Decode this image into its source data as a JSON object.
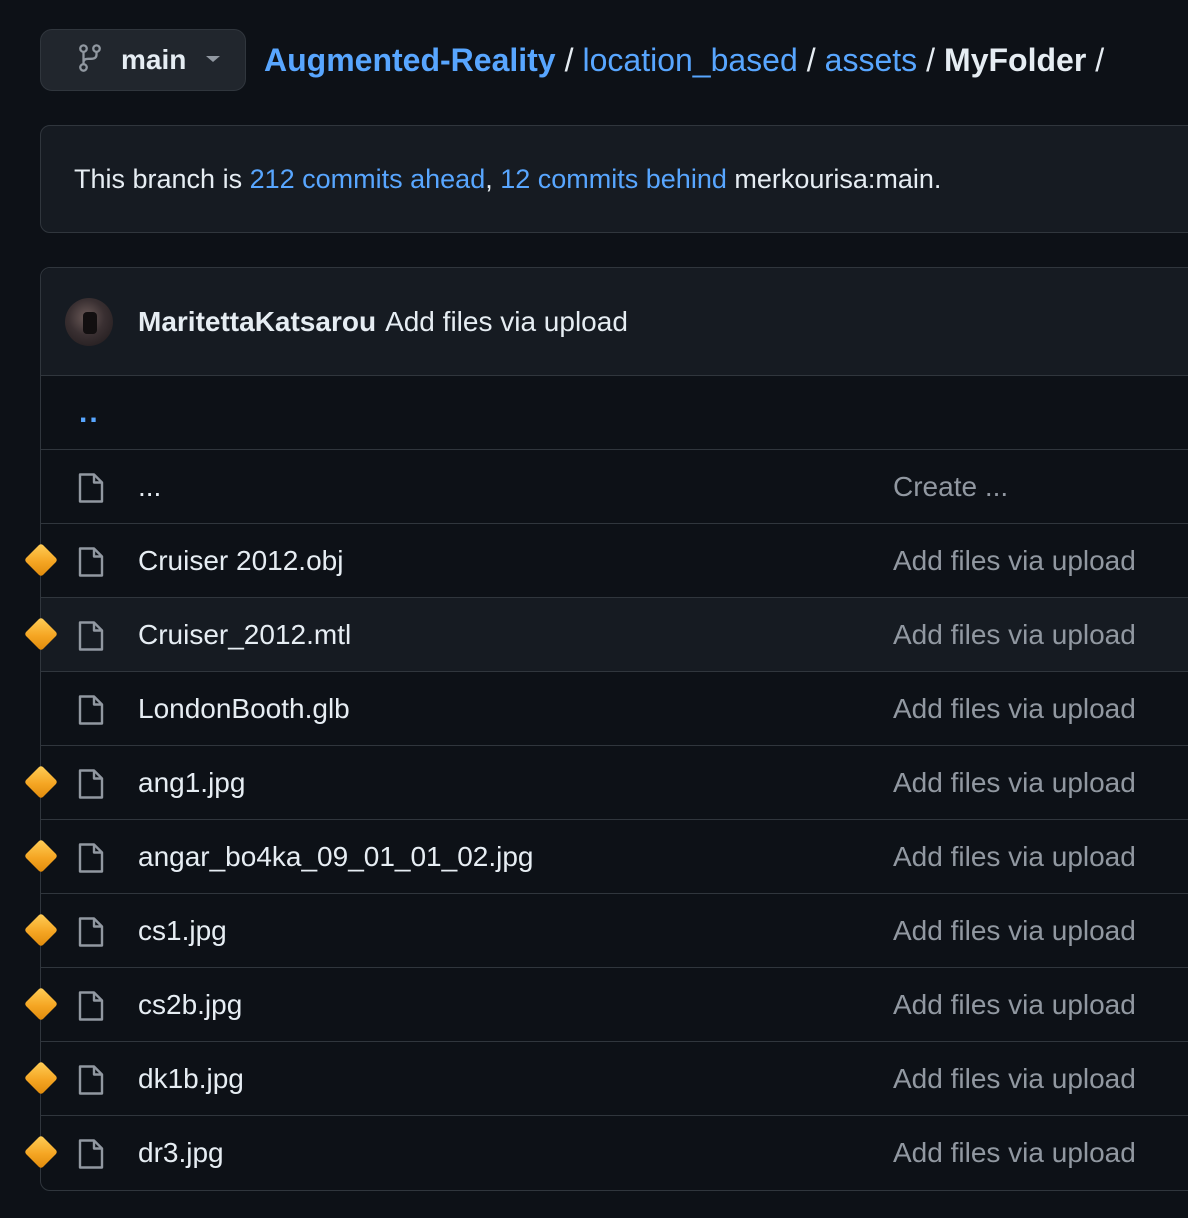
{
  "branch": {
    "name": "main",
    "icon": "git-branch-icon",
    "caret_icon": "caret-down-icon"
  },
  "breadcrumb": {
    "repo": "Augmented-Reality",
    "parts": [
      "location_based",
      "assets"
    ],
    "current": "MyFolder",
    "separator": "/"
  },
  "branch_status": {
    "prefix": "This branch is ",
    "ahead": "212 commits ahead",
    "comma": ", ",
    "behind": "12 commits behind",
    "suffix": " merkourisa:main."
  },
  "latest_commit": {
    "author": "MaritettaKatsarou",
    "message": "Add files via upload"
  },
  "parent_dir": "..",
  "files": [
    {
      "name": "...",
      "commit": "Create ...",
      "marker": false,
      "highlighted": false
    },
    {
      "name": "Cruiser 2012.obj",
      "commit": "Add files via upload",
      "marker": true,
      "highlighted": false
    },
    {
      "name": "Cruiser_2012.mtl",
      "commit": "Add files via upload",
      "marker": true,
      "highlighted": true
    },
    {
      "name": "LondonBooth.glb",
      "commit": "Add files via upload",
      "marker": false,
      "highlighted": false
    },
    {
      "name": "ang1.jpg",
      "commit": "Add files via upload",
      "marker": true,
      "highlighted": false
    },
    {
      "name": "angar_bo4ka_09_01_01_02.jpg",
      "commit": "Add files via upload",
      "marker": true,
      "highlighted": false
    },
    {
      "name": "cs1.jpg",
      "commit": "Add files via upload",
      "marker": true,
      "highlighted": false
    },
    {
      "name": "cs2b.jpg",
      "commit": "Add files via upload",
      "marker": true,
      "highlighted": false
    },
    {
      "name": "dk1b.jpg",
      "commit": "Add files via upload",
      "marker": true,
      "highlighted": false
    },
    {
      "name": "dr3.jpg",
      "commit": "Add files via upload",
      "marker": true,
      "highlighted": false
    }
  ],
  "colors": {
    "background": "#0d1117",
    "link": "#58a6ff",
    "marker": "#f5a623",
    "muted": "#9198a1"
  }
}
